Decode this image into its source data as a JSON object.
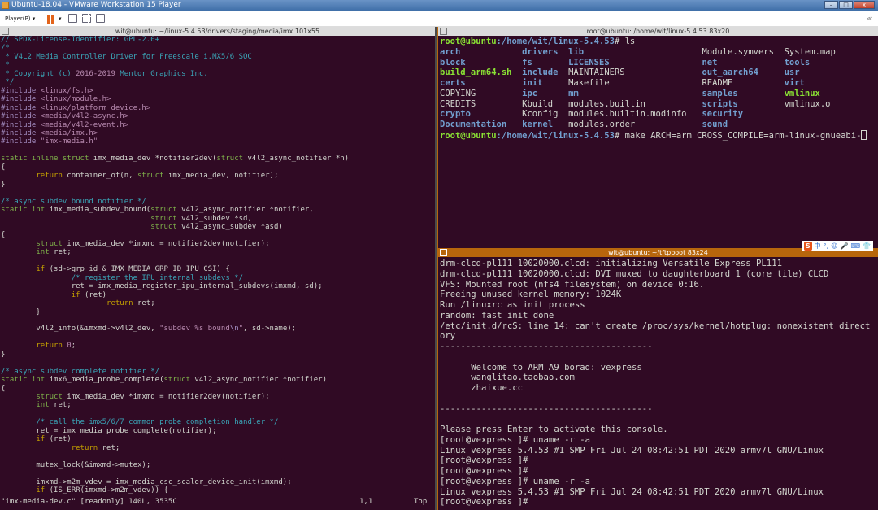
{
  "window": {
    "title": "Ubuntu-18.04 - VMware Workstation 15 Player",
    "controls": [
      "minimize",
      "maximize",
      "close"
    ]
  },
  "toolbar": {
    "player_menu": "Player(P)",
    "dropdown_glyph": "▾",
    "right_glyph": "≪",
    "icons": [
      "pause-icon",
      "send-ctrl-alt-del-icon",
      "fullscreen-icon",
      "unity-icon"
    ],
    "accent": "#e2641b"
  },
  "left_terminal": {
    "title": "wit@ubuntu: ~/linux-5.4.53/drivers/staging/media/imx 101x55",
    "lines": [
      [
        [
          "c",
          "// SPDX-License-Identifier: GPL-2.0+"
        ]
      ],
      [
        [
          "c",
          "/*"
        ]
      ],
      [
        [
          "c",
          " * V4L2 Media Controller Driver for Freescale i.MX5/6 SOC"
        ]
      ],
      [
        [
          "c",
          " *"
        ]
      ],
      [
        [
          "c",
          " * Copyright (c) "
        ],
        [
          "s",
          "2016-2019"
        ],
        [
          "c",
          " Mentor Graphics Inc."
        ]
      ],
      [
        [
          "c",
          " */"
        ]
      ],
      [
        [
          "p",
          "#include "
        ],
        [
          "s",
          "<linux/fs.h>"
        ]
      ],
      [
        [
          "p",
          "#include "
        ],
        [
          "s",
          "<linux/module.h>"
        ]
      ],
      [
        [
          "p",
          "#include "
        ],
        [
          "s",
          "<linux/platform_device.h>"
        ]
      ],
      [
        [
          "p",
          "#include "
        ],
        [
          "s",
          "<media/v4l2-async.h>"
        ]
      ],
      [
        [
          "p",
          "#include "
        ],
        [
          "s",
          "<media/v4l2-event.h>"
        ]
      ],
      [
        [
          "p",
          "#include "
        ],
        [
          "s",
          "<media/imx.h>"
        ]
      ],
      [
        [
          "p",
          "#include "
        ],
        [
          "s",
          "\"imx-media.h\""
        ]
      ],
      [],
      [
        [
          "k",
          "static inline struct"
        ],
        [
          "n",
          " imx_media_dev *notifier2dev("
        ],
        [
          "k",
          "struct"
        ],
        [
          "n",
          " v4l2_async_notifier *n)"
        ]
      ],
      [
        [
          "n",
          "{"
        ]
      ],
      [
        [
          "n",
          "\t"
        ],
        [
          "r",
          "return"
        ],
        [
          "n",
          " container_of(n, "
        ],
        [
          "k",
          "struct"
        ],
        [
          "n",
          " imx_media_dev, notifier);"
        ]
      ],
      [
        [
          "n",
          "}"
        ]
      ],
      [],
      [
        [
          "c",
          "/* async subdev bound notifier */"
        ]
      ],
      [
        [
          "k",
          "static int"
        ],
        [
          "n",
          " imx_media_subdev_bound("
        ],
        [
          "k",
          "struct"
        ],
        [
          "n",
          " v4l2_async_notifier *notifier,"
        ]
      ],
      [
        [
          "n",
          "\t\t\t\t  "
        ],
        [
          "k",
          "struct"
        ],
        [
          "n",
          " v4l2_subdev *sd,"
        ]
      ],
      [
        [
          "n",
          "\t\t\t\t  "
        ],
        [
          "k",
          "struct"
        ],
        [
          "n",
          " v4l2_async_subdev *asd)"
        ]
      ],
      [
        [
          "n",
          "{"
        ]
      ],
      [
        [
          "n",
          "\t"
        ],
        [
          "k",
          "struct"
        ],
        [
          "n",
          " imx_media_dev *imxmd = notifier2dev(notifier);"
        ]
      ],
      [
        [
          "n",
          "\t"
        ],
        [
          "k",
          "int"
        ],
        [
          "n",
          " ret;"
        ]
      ],
      [],
      [
        [
          "n",
          "\t"
        ],
        [
          "r",
          "if"
        ],
        [
          "n",
          " (sd->grp_id & IMX_MEDIA_GRP_ID_IPU_CSI) {"
        ]
      ],
      [
        [
          "n",
          "\t\t"
        ],
        [
          "c",
          "/* register the IPU internal subdevs */"
        ]
      ],
      [
        [
          "n",
          "\t\tret = imx_media_register_ipu_internal_subdevs(imxmd, sd);"
        ]
      ],
      [
        [
          "n",
          "\t\t"
        ],
        [
          "r",
          "if"
        ],
        [
          "n",
          " (ret)"
        ]
      ],
      [
        [
          "n",
          "\t\t\t"
        ],
        [
          "r",
          "return"
        ],
        [
          "n",
          " ret;"
        ]
      ],
      [
        [
          "n",
          "\t}"
        ]
      ],
      [],
      [
        [
          "n",
          "\tv4l2_info(&imxmd->v4l2_dev, "
        ],
        [
          "s",
          "\"subdev %s bound"
        ],
        [
          "p",
          "\\n"
        ],
        [
          "s",
          "\""
        ],
        [
          "n",
          ", sd->name);"
        ]
      ],
      [],
      [
        [
          "n",
          "\t"
        ],
        [
          "r",
          "return"
        ],
        [
          "n",
          " "
        ],
        [
          "s",
          "0"
        ],
        [
          "n",
          ";"
        ]
      ],
      [
        [
          "n",
          "}"
        ]
      ],
      [],
      [
        [
          "c",
          "/* async subdev complete notifier */"
        ]
      ],
      [
        [
          "k",
          "static int"
        ],
        [
          "n",
          " imx6_media_probe_complete("
        ],
        [
          "k",
          "struct"
        ],
        [
          "n",
          " v4l2_async_notifier *notifier)"
        ]
      ],
      [
        [
          "n",
          "{"
        ]
      ],
      [
        [
          "n",
          "\t"
        ],
        [
          "k",
          "struct"
        ],
        [
          "n",
          " imx_media_dev *imxmd = notifier2dev(notifier);"
        ]
      ],
      [
        [
          "n",
          "\t"
        ],
        [
          "k",
          "int"
        ],
        [
          "n",
          " ret;"
        ]
      ],
      [],
      [
        [
          "n",
          "\t"
        ],
        [
          "c",
          "/* call the imx5/6/7 common probe completion handler */"
        ]
      ],
      [
        [
          "n",
          "\tret = imx_media_probe_complete(notifier);"
        ]
      ],
      [
        [
          "n",
          "\t"
        ],
        [
          "r",
          "if"
        ],
        [
          "n",
          " (ret)"
        ]
      ],
      [
        [
          "n",
          "\t\t"
        ],
        [
          "r",
          "return"
        ],
        [
          "n",
          " ret;"
        ]
      ],
      [],
      [
        [
          "n",
          "\tmutex_lock(&imxmd->mutex);"
        ]
      ],
      [],
      [
        [
          "n",
          "\timxmd->m2m_vdev = imx_media_csc_scaler_device_init(imxmd);"
        ]
      ],
      [
        [
          "n",
          "\t"
        ],
        [
          "r",
          "if"
        ],
        [
          "n",
          " (IS_ERR(imxmd->m2m_vdev)) {"
        ]
      ]
    ],
    "status": {
      "file": "\"imx-media-dev.c\" [readonly] 140L, 3535C",
      "position": "1,1",
      "scroll": "Top"
    }
  },
  "top_right_terminal": {
    "title": "root@ubuntu: /home/wit/linux-5.4.53 83x20",
    "prompt_user": "root@ubuntu",
    "prompt_path": ":/home/wit/linux-5.4.53",
    "prompt_end": "# ",
    "command1": "ls",
    "ls_rows": [
      [
        [
          "b",
          "arch"
        ],
        [
          "b",
          "drivers"
        ],
        [
          "b",
          "lib"
        ],
        [
          "w",
          "Module.symvers"
        ],
        [
          "w",
          "System.map"
        ]
      ],
      [
        [
          "b",
          "block"
        ],
        [
          "b",
          "fs"
        ],
        [
          "b",
          "LICENSES"
        ],
        [
          "b",
          "net"
        ],
        [
          "b",
          "tools"
        ]
      ],
      [
        [
          "g",
          "build_arm64.sh"
        ],
        [
          "b",
          "include"
        ],
        [
          "w",
          "MAINTAINERS"
        ],
        [
          "b",
          "out_aarch64"
        ],
        [
          "b",
          "usr"
        ]
      ],
      [
        [
          "b",
          "certs"
        ],
        [
          "b",
          "init"
        ],
        [
          "w",
          "Makefile"
        ],
        [
          "w",
          "README"
        ],
        [
          "b",
          "virt"
        ]
      ],
      [
        [
          "w",
          "COPYING"
        ],
        [
          "b",
          "ipc"
        ],
        [
          "b",
          "mm"
        ],
        [
          "b",
          "samples"
        ],
        [
          "g",
          "vmlinux"
        ]
      ],
      [
        [
          "w",
          "CREDITS"
        ],
        [
          "w",
          "Kbuild"
        ],
        [
          "w",
          "modules.builtin"
        ],
        [
          "b",
          "scripts"
        ],
        [
          "w",
          "vmlinux.o"
        ]
      ],
      [
        [
          "b",
          "crypto"
        ],
        [
          "w",
          "Kconfig"
        ],
        [
          "w",
          "modules.builtin.modinfo"
        ],
        [
          "b",
          "security"
        ],
        [
          "w",
          ""
        ]
      ],
      [
        [
          "b",
          "Documentation"
        ],
        [
          "b",
          "kernel"
        ],
        [
          "w",
          "modules.order"
        ],
        [
          "b",
          "sound"
        ],
        [
          "w",
          ""
        ]
      ]
    ],
    "command2": "make ARCH=arm CROSS_COMPILE=arm-linux-gnueabi-"
  },
  "bottom_right_terminal": {
    "title": "wit@ubuntu: ~/tftpboot 83x24",
    "ime": {
      "logo": "S",
      "items": [
        "中",
        "°,",
        "☺",
        "🎤",
        "⌨",
        "👕"
      ]
    },
    "lines": [
      "drm-clcd-pl111 10020000.clcd: initializing Versatile Express PL111",
      "drm-clcd-pl111 10020000.clcd: DVI muxed to daughterboard 1 (core tile) CLCD",
      "VFS: Mounted root (nfs4 filesystem) on device 0:16.",
      "Freeing unused kernel memory: 1024K",
      "Run /linuxrc as init process",
      "random: fast init done",
      "/etc/init.d/rcS: line 14: can't create /proc/sys/kernel/hotplug: nonexistent direct",
      "ory",
      "-----------------------------------------",
      "",
      "      Welcome to ARM A9 borad: vexpress",
      "      wanglitao.taobao.com",
      "      zhaixue.cc",
      "",
      "-----------------------------------------",
      "",
      "Please press Enter to activate this console.",
      "[root@vexpress ]# uname -r -a",
      "Linux vexpress 5.4.53 #1 SMP Fri Jul 24 08:42:51 PDT 2020 armv7l GNU/Linux",
      "[root@vexpress ]#",
      "[root@vexpress ]#",
      "[root@vexpress ]# uname -r -a",
      "Linux vexpress 5.4.53 #1 SMP Fri Jul 24 08:42:51 PDT 2020 armv7l GNU/Linux",
      "[root@vexpress ]#"
    ]
  },
  "colors": {
    "terminal_bg": "#300a24",
    "text": "#d3d7cf",
    "prompt_green": "#8ae234",
    "dir_blue": "#729fcf",
    "comment": "#3aa6b8",
    "keyword": "#7fb24a",
    "return": "#c4a000",
    "active_title": "#b7660c"
  }
}
